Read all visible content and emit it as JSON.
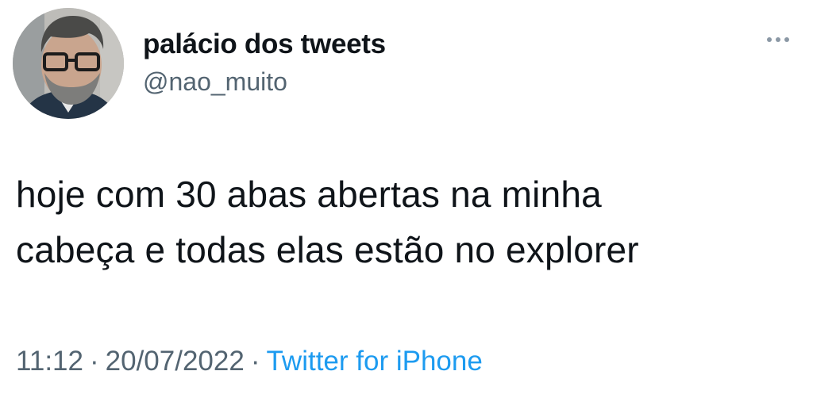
{
  "user": {
    "display_name": "palácio dos tweets",
    "handle": "@nao_muito",
    "avatar_icon": "user-avatar-photo"
  },
  "more_icon": "more-horizontal-icon",
  "tweet": {
    "lines": [
      "hoje com 30 abas abertas na minha",
      "cabeça e todas elas estão no explorer"
    ]
  },
  "meta": {
    "time": "11:12",
    "separator": "·",
    "date": "20/07/2022",
    "source": "Twitter for iPhone"
  },
  "colors": {
    "text": "#0f1419",
    "secondary": "#536471",
    "link": "#1d9bf0"
  }
}
